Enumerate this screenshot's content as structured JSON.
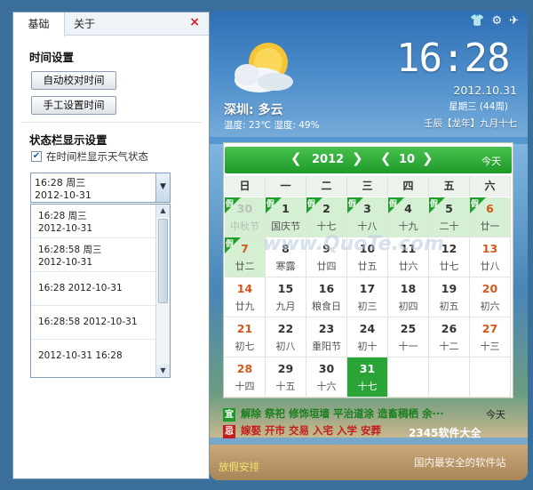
{
  "settings": {
    "tabs": [
      "基础",
      "关于"
    ],
    "close": "×",
    "time_section": "时间设置",
    "auto_sync_button": "自动校对时间",
    "manual_set_button": "手工设置时间",
    "statusbar_section": "状态栏显示设置",
    "show_weather_checkbox": "在时间栏显示天气状态",
    "show_weather_checked": true,
    "combo": {
      "line1": "16:28 周三",
      "line2": "2012-10-31"
    },
    "dropdown_options": [
      {
        "line1": "16:28 周三",
        "line2": "2012-10-31"
      },
      {
        "line1": "16:28:58 周三",
        "line2": "2012-10-31"
      },
      {
        "line1": "16:28 2012-10-31",
        "line2": ""
      },
      {
        "line1": "16:28:58 2012-10-31",
        "line2": ""
      },
      {
        "line1": "2012-10-31 16:28",
        "line2": ""
      }
    ]
  },
  "widget": {
    "clock": "16:28",
    "date": "2012.10.31",
    "weekday": "星期三 (44周)",
    "lunar": "壬辰【龙年】九月十七",
    "city": "深圳: 多云",
    "temp": "温度: 23℃ 湿度: 49%",
    "top_icons": [
      "shirt-icon",
      "gear-icon",
      "pin-icon"
    ]
  },
  "calendar": {
    "year": "2012",
    "month": "10",
    "today_label": "今天",
    "weekdays": [
      "日",
      "一",
      "二",
      "三",
      "四",
      "五",
      "六"
    ],
    "holiday_mark": "假",
    "rows": [
      [
        {
          "d": "30",
          "l": "中秋节",
          "other": true,
          "hol": true
        },
        {
          "d": "1",
          "l": "国庆节",
          "hol": true
        },
        {
          "d": "2",
          "l": "十七",
          "hol": true
        },
        {
          "d": "3",
          "l": "十八",
          "hol": true
        },
        {
          "d": "4",
          "l": "十九",
          "hol": true
        },
        {
          "d": "5",
          "l": "二十",
          "hol": true
        },
        {
          "d": "6",
          "l": "廿一",
          "hol": true,
          "we": true
        }
      ],
      [
        {
          "d": "7",
          "l": "廿二",
          "hol": true,
          "we": true
        },
        {
          "d": "8",
          "l": "寒露"
        },
        {
          "d": "9",
          "l": "廿四"
        },
        {
          "d": "10",
          "l": "廿五"
        },
        {
          "d": "11",
          "l": "廿六"
        },
        {
          "d": "12",
          "l": "廿七"
        },
        {
          "d": "13",
          "l": "廿八",
          "we": true
        }
      ],
      [
        {
          "d": "14",
          "l": "廿九",
          "we": true
        },
        {
          "d": "15",
          "l": "九月"
        },
        {
          "d": "16",
          "l": "粮食日"
        },
        {
          "d": "17",
          "l": "初三"
        },
        {
          "d": "18",
          "l": "初四"
        },
        {
          "d": "19",
          "l": "初五"
        },
        {
          "d": "20",
          "l": "初六",
          "we": true
        }
      ],
      [
        {
          "d": "21",
          "l": "初七",
          "we": true
        },
        {
          "d": "22",
          "l": "初八"
        },
        {
          "d": "23",
          "l": "重阳节"
        },
        {
          "d": "24",
          "l": "初十"
        },
        {
          "d": "25",
          "l": "十一"
        },
        {
          "d": "26",
          "l": "十二"
        },
        {
          "d": "27",
          "l": "十三",
          "we": true
        }
      ],
      [
        {
          "d": "28",
          "l": "十四",
          "we": true
        },
        {
          "d": "29",
          "l": "十五"
        },
        {
          "d": "30",
          "l": "十六"
        },
        {
          "d": "31",
          "l": "十七",
          "today": true
        },
        {
          "d": "",
          "l": ""
        },
        {
          "d": "",
          "l": ""
        },
        {
          "d": "",
          "l": ""
        }
      ]
    ],
    "yi_tag": "宜",
    "yi_text": "解除 祭祀 修饰垣墙 平治道涂 造畜稠栖 余···",
    "ji_tag": "忌",
    "ji_text": "嫁娶 开市 交易 入宅 入学 安葬",
    "yi_today": "今天"
  },
  "footer": {
    "holiday_link": "放假安排",
    "watermark": "国内最安全的软件站",
    "logo_text": "2345软件大全",
    "site_watermark": "www.QuoTe.com"
  },
  "colors": {
    "accent_green": "#1e9a2a",
    "weekend": "#d2581c",
    "ji_red": "#c41e1e"
  }
}
